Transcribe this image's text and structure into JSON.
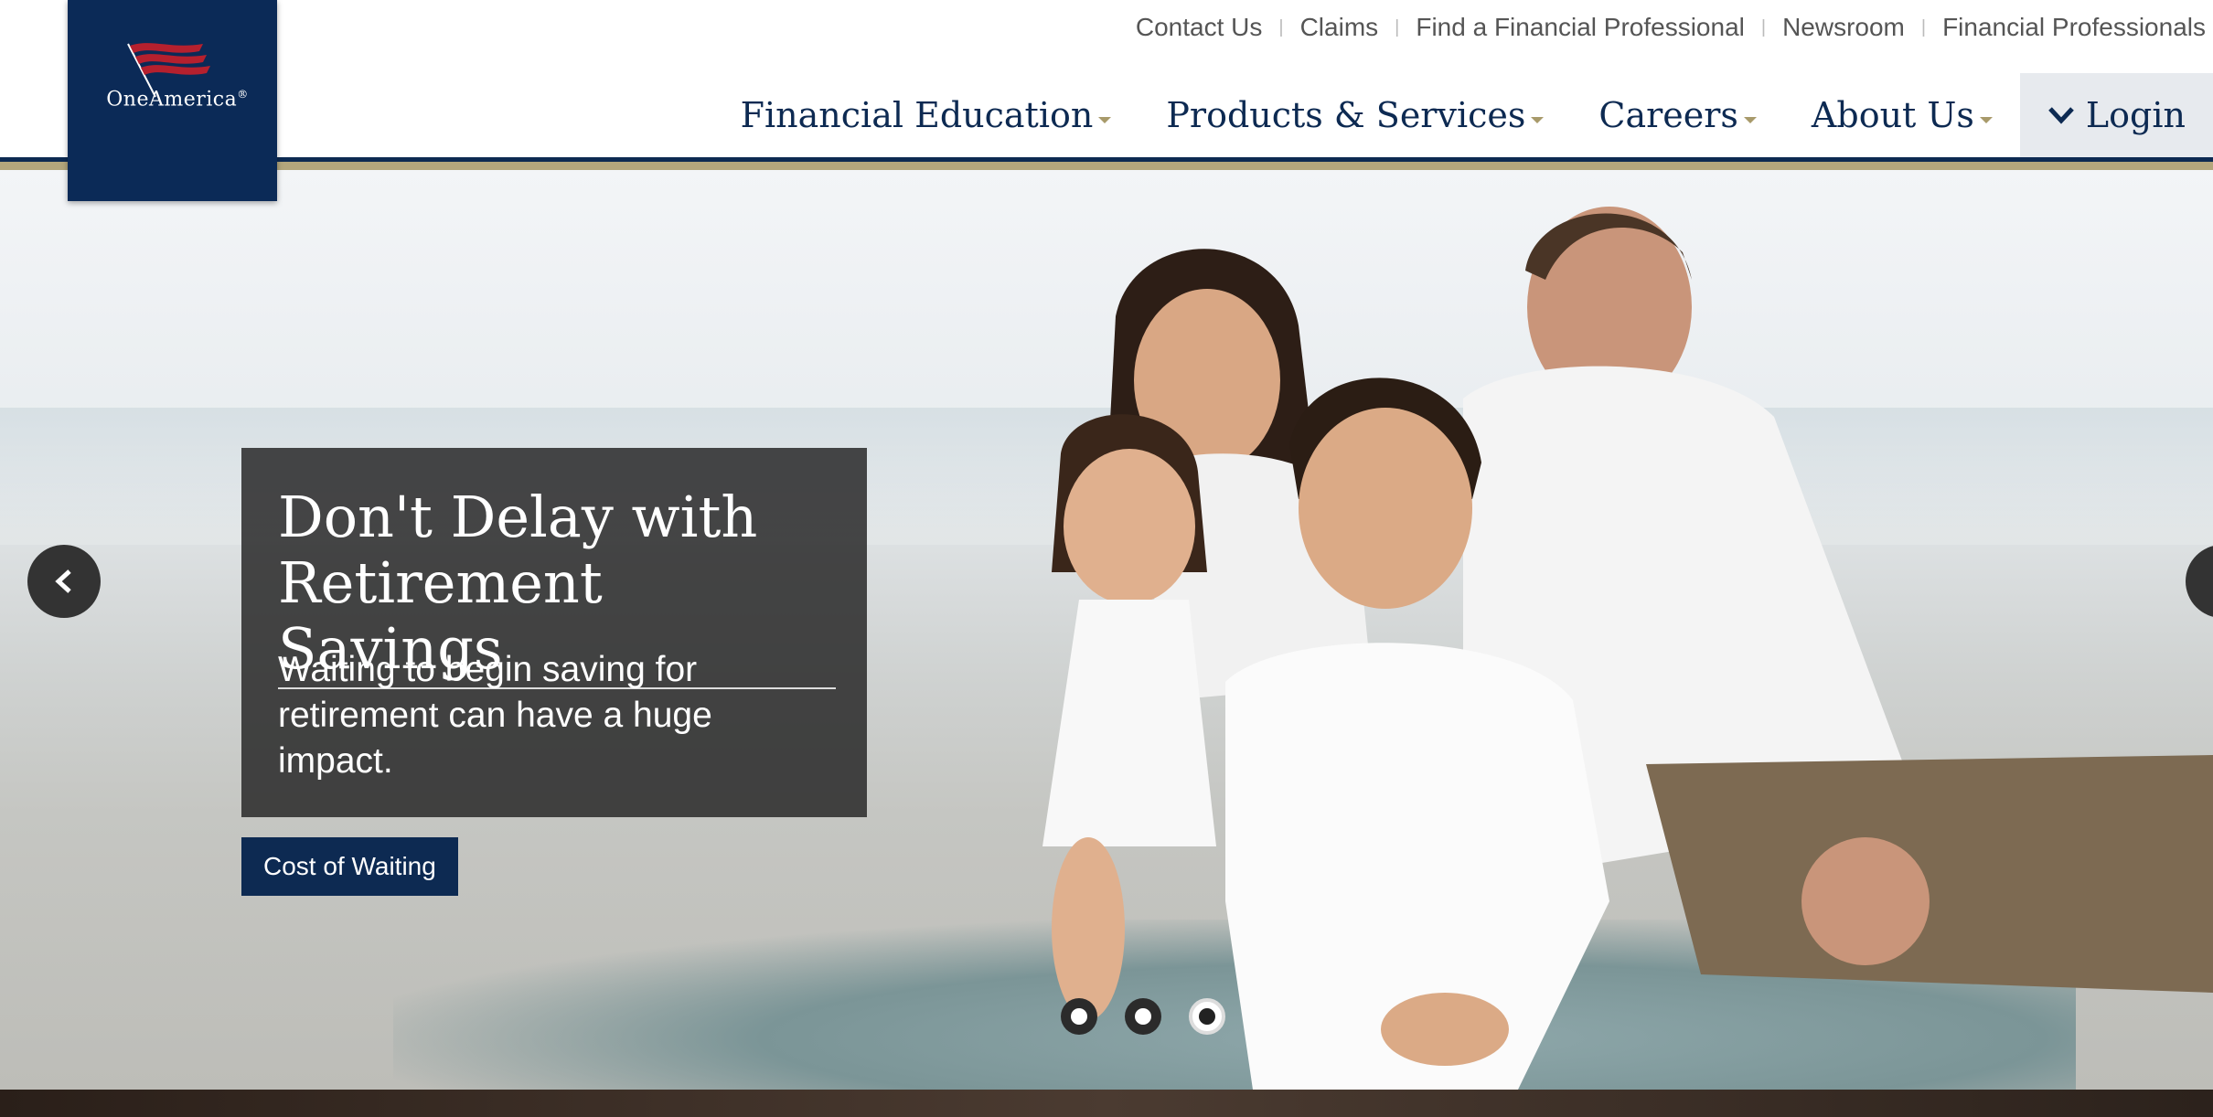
{
  "brand": {
    "logo_text": "OneAmerica",
    "registered_mark": "®",
    "primary_color": "#0b2a57",
    "accent_gold": "#b3a67c"
  },
  "utility_nav": [
    {
      "label": "Contact Us"
    },
    {
      "label": "Claims"
    },
    {
      "label": "Find a Financial Professional"
    },
    {
      "label": "Newsroom"
    },
    {
      "label": "Financial Professionals"
    }
  ],
  "main_nav": [
    {
      "label": "Financial Education"
    },
    {
      "label": "Products & Services"
    },
    {
      "label": "Careers"
    },
    {
      "label": "About Us"
    }
  ],
  "login": {
    "label": "Login",
    "icon": "chevron-down-icon"
  },
  "hero": {
    "title": "Don't Delay with Retirement Savings",
    "text": "Waiting to begin saving for retirement can have a huge impact.",
    "cta_label": "Cost of Waiting",
    "slides": 3,
    "active_slide": 3
  }
}
